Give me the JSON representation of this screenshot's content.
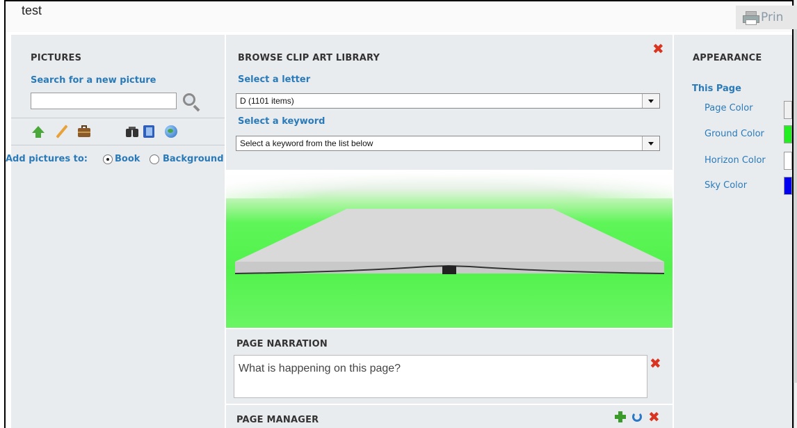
{
  "app": {
    "title": "test",
    "print_label": "Prin"
  },
  "pictures": {
    "heading": "PICTURES",
    "search_label": "Search for a new picture",
    "search_value": "",
    "tools": [
      "upload-icon",
      "pencil-icon",
      "briefcase-icon",
      "binoculars-icon",
      "book-icon",
      "globe-icon"
    ],
    "add_to_label": "Add pictures to:",
    "options": [
      {
        "label": "Book",
        "selected": true
      },
      {
        "label": "Background",
        "selected": false
      }
    ]
  },
  "clipart": {
    "heading": "BROWSE CLIP ART LIBRARY",
    "letter_label": "Select a letter",
    "letter_value": "D (1101 items)",
    "keyword_label": "Select a keyword",
    "keyword_value": "Select a keyword from the list below"
  },
  "narration": {
    "heading": "PAGE NARRATION",
    "placeholder": "What is happening on this page?"
  },
  "page_manager": {
    "heading": "PAGE MANAGER"
  },
  "appearance": {
    "heading": "APPEARANCE",
    "subheading": "This Page",
    "items": [
      {
        "label": "Page Color",
        "color": "#f0f0f0"
      },
      {
        "label": "Ground Color",
        "color": "#22ee22"
      },
      {
        "label": "Horizon Color",
        "color": "#ffffff"
      },
      {
        "label": "Sky Color",
        "color": "#0000ee"
      }
    ]
  },
  "colors": {
    "accent_blue": "#2a7ab8",
    "close_red": "#d9341f",
    "panel_bg": "#e9ecef"
  }
}
